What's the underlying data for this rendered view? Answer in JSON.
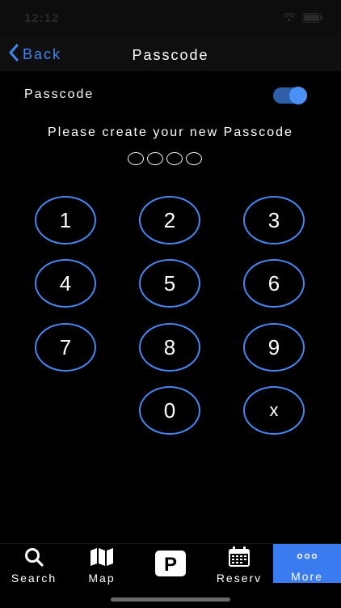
{
  "status_bar": {
    "time": "12:12"
  },
  "nav": {
    "back_label": "Back",
    "title": "Passcode"
  },
  "passcode_toggle": {
    "label": "Passcode",
    "enabled": true
  },
  "prompt": "Please create your new Passcode",
  "passcode_entry": {
    "digits_total": 4,
    "digits_entered": 0
  },
  "keypad": {
    "keys": [
      "1",
      "2",
      "3",
      "4",
      "5",
      "6",
      "7",
      "8",
      "9",
      "0",
      "x"
    ]
  },
  "tab_bar": {
    "tabs": [
      {
        "label": "Search",
        "icon": "search-icon"
      },
      {
        "label": "Map",
        "icon": "map-icon"
      },
      {
        "label": "",
        "icon": "parking-icon"
      },
      {
        "label": "Reserv",
        "icon": "calendar-icon"
      },
      {
        "label": "More",
        "icon": "more-icon",
        "selected": true
      }
    ]
  },
  "colors": {
    "background": "#000000",
    "accent": "#3f86f0",
    "key_border": "#4a86f0",
    "selected_tab": "#3a7cf0"
  }
}
